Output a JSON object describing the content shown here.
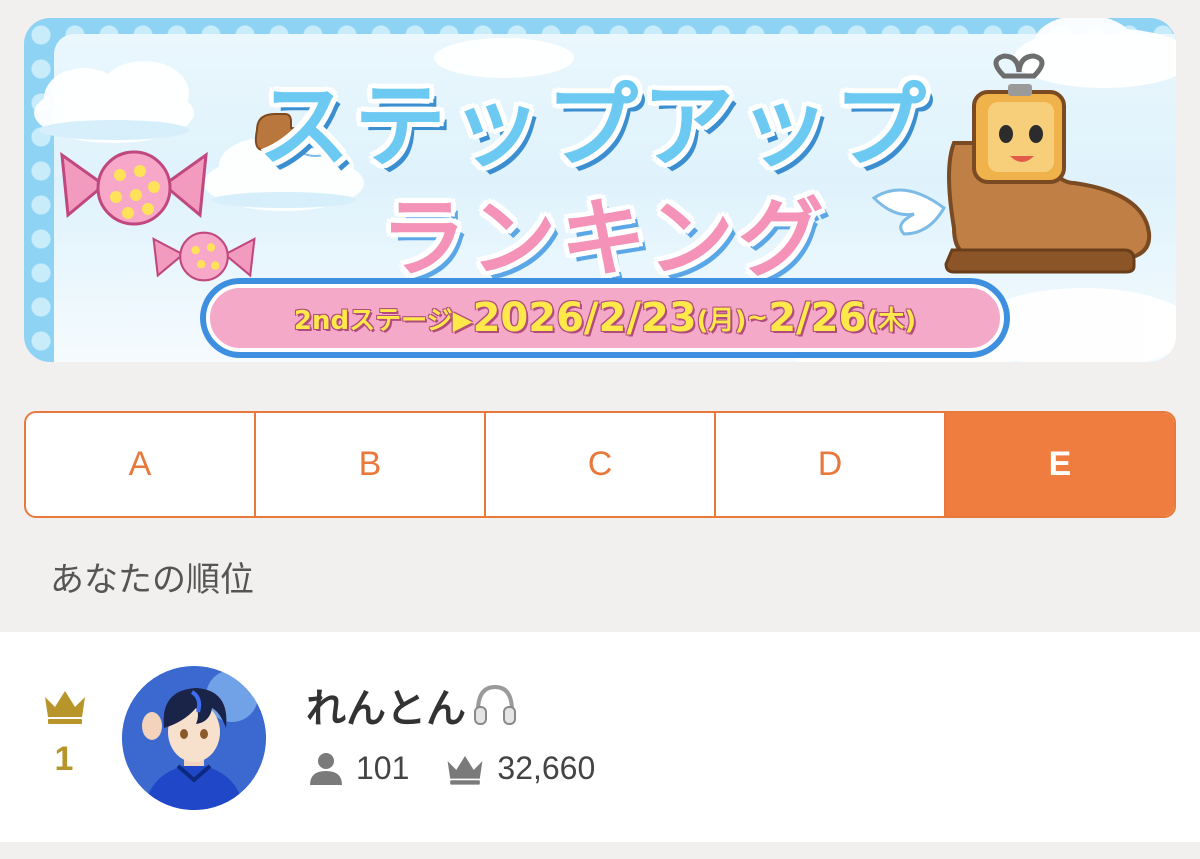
{
  "banner": {
    "title_line1": "ステップアップ",
    "title_line2": "ランキング",
    "stage_label": "2ndステージ▶",
    "date_start": "2026/2/23",
    "date_start_day": "(月)",
    "date_sep": "~",
    "date_end": "2/26",
    "date_end_day": "(木)"
  },
  "tabs": [
    {
      "label": "A",
      "active": false
    },
    {
      "label": "B",
      "active": false
    },
    {
      "label": "C",
      "active": false
    },
    {
      "label": "D",
      "active": false
    },
    {
      "label": "E",
      "active": true
    }
  ],
  "section": {
    "label": "あなたの順位"
  },
  "ranking": {
    "rank": "1",
    "name": "れんとん",
    "followers_icon": "person-icon",
    "followers": "101",
    "points_icon": "crown-icon",
    "points": "32,660"
  },
  "colors": {
    "accent": "#ef7d3f",
    "gold": "#b7952a",
    "banner_blue": "#8fd3f4",
    "banner_pink": "#f493b7"
  }
}
